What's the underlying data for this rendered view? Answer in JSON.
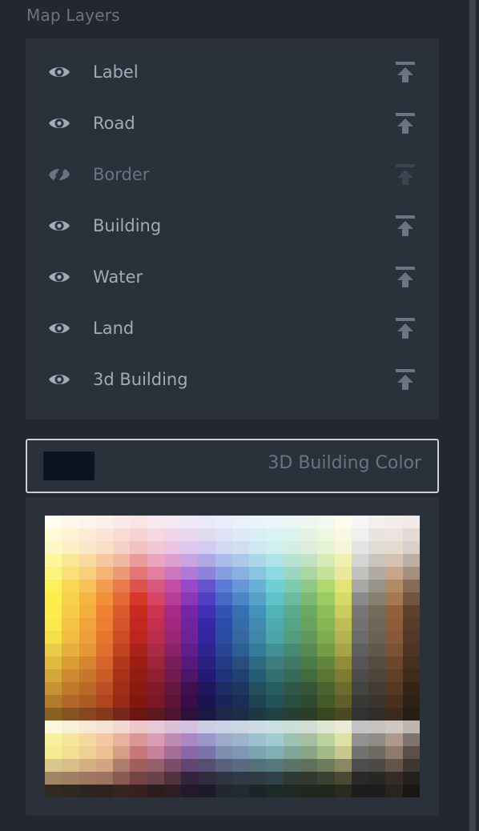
{
  "section_title": "Map Layers",
  "layers": [
    {
      "label": "Label",
      "visible": true,
      "eye_icon": "eye-icon",
      "action_icon": "move-to-top-icon"
    },
    {
      "label": "Road",
      "visible": true,
      "eye_icon": "eye-icon",
      "action_icon": "move-to-top-icon"
    },
    {
      "label": "Border",
      "visible": false,
      "eye_icon": "eye-slash-icon",
      "action_icon": "move-to-top-icon"
    },
    {
      "label": "Building",
      "visible": true,
      "eye_icon": "eye-icon",
      "action_icon": "move-to-top-icon"
    },
    {
      "label": "Water",
      "visible": true,
      "eye_icon": "eye-icon",
      "action_icon": "move-to-top-icon"
    },
    {
      "label": "Land",
      "visible": true,
      "eye_icon": "eye-icon",
      "action_icon": "move-to-top-icon"
    },
    {
      "label": "3d Building",
      "visible": true,
      "eye_icon": "eye-icon",
      "action_icon": "move-to-top-icon"
    }
  ],
  "color_picker": {
    "label": "3D Building Color",
    "selected_color": "#0c1320"
  },
  "colors": {
    "icon_visible": "#a3a9b5",
    "icon_hidden": "#6b7280",
    "action_visible": "#6b7384",
    "action_hidden": "#3f4550"
  },
  "palette": [
    [
      "#fffeee",
      "#fef8ec",
      "#fdf5ec",
      "#fbf0ea",
      "#f9ebea",
      "#f9e5e5",
      "#f8e9f0",
      "#f4e8f2",
      "#efe8f7",
      "#ebe9f7",
      "#eaedf9",
      "#e9f1f9",
      "#e9f4f9",
      "#e8f7fa",
      "#ecf7f5",
      "#eff6ef",
      "#f3f9ee",
      "#fbfcec",
      "#f6f6f7",
      "#f2f1ee",
      "#f3eeea",
      "#f0ebe8"
    ],
    [
      "#fefbd6",
      "#fef4d2",
      "#fcecd6",
      "#fbe5d7",
      "#f8dcd4",
      "#f5d2d4",
      "#f6d8e2",
      "#f0d6ea",
      "#e9d8f1",
      "#e1dbf1",
      "#dde2f6",
      "#dde9f5",
      "#dceef5",
      "#d9f2f6",
      "#dcf2ec",
      "#e6f0e5",
      "#eef7df",
      "#f8f8e3",
      "#f0f0f0",
      "#e8e5e1",
      "#ede4df",
      "#e3dcd6"
    ],
    [
      "#fef8c4",
      "#fcf0c4",
      "#fae8c9",
      "#f9dfc6",
      "#f6d2c6",
      "#f2c2c3",
      "#f2c8d7",
      "#eac4e3",
      "#dec7ee",
      "#d1cdf0",
      "#d1d9f2",
      "#cfdff0",
      "#cfe6f3",
      "#cfeff1",
      "#d5eee4",
      "#dcedd9",
      "#e6f4d4",
      "#f5f6d9",
      "#e3e3e3",
      "#dfdcd6",
      "#e5dace",
      "#d9d0cb"
    ],
    [
      "#fef89a",
      "#fbe897",
      "#f8da9e",
      "#f7c8a0",
      "#f0b7a2",
      "#e89c9d",
      "#eba6be",
      "#dca1d3",
      "#c9a3e2",
      "#b0a8e4",
      "#adbde9",
      "#acc9e8",
      "#acd7e8",
      "#aee4e8",
      "#b6e2d4",
      "#c5e1c4",
      "#d6ebb6",
      "#f0f1b0",
      "#d4d4d2",
      "#c9c4bc",
      "#d6c2b0",
      "#bcafa4"
    ],
    [
      "#fdf47e",
      "#fbdf7b",
      "#f8cf7c",
      "#f4b478",
      "#eb9a75",
      "#e37673",
      "#e17fa0",
      "#cd78bd",
      "#b078d7",
      "#8b84da",
      "#879fe0",
      "#88b1de",
      "#8ac5df",
      "#8ddbe0",
      "#9ad6c2",
      "#abd6a2",
      "#c3e399",
      "#eae89b",
      "#c1c1c1",
      "#b0aaa0",
      "#c7a588",
      "#a48f82"
    ],
    [
      "#fdf05a",
      "#f9d755",
      "#f6c35a",
      "#f19c4f",
      "#e87b4b",
      "#db544b",
      "#d9567c",
      "#c04ea4",
      "#9849c8",
      "#6553cd",
      "#5b7cd4",
      "#6698d7",
      "#67b2d4",
      "#6ecfd5",
      "#7ccbae",
      "#90c789",
      "#add970",
      "#e3e477",
      "#a7a7a7",
      "#99948a",
      "#b38a66",
      "#866c57"
    ],
    [
      "#fdee4b",
      "#f8d04a",
      "#f5b542",
      "#f19039",
      "#e36935",
      "#d5372b",
      "#d64466",
      "#b53f97",
      "#8b38b8",
      "#4d3ec2",
      "#466ac4",
      "#4c86c6",
      "#54a2c9",
      "#5ec3ca",
      "#6bbba0",
      "#7fb874",
      "#9bcc63",
      "#d5db67",
      "#8b8b8b",
      "#858070",
      "#a37852",
      "#715540"
    ],
    [
      "#fcec4e",
      "#f8cb46",
      "#f4ae3c",
      "#ef8231",
      "#dc5a2f",
      "#cb2a1f",
      "#cc3551",
      "#a82a86",
      "#7624a8",
      "#3d30b2",
      "#3053b4",
      "#3770b2",
      "#4094bb",
      "#51b3b8",
      "#58ab8c",
      "#6aa962",
      "#8bbe56",
      "#cacd5d",
      "#767676",
      "#756d5c",
      "#925f3b",
      "#5d412a"
    ],
    [
      "#fbe84d",
      "#f6c246",
      "#f2a43c",
      "#ec7d31",
      "#d4542c",
      "#c2281f",
      "#c3304f",
      "#a0277e",
      "#70239e",
      "#3528a6",
      "#2b4da9",
      "#356ba9",
      "#418cae",
      "#4fabb2",
      "#56a487",
      "#68a25e",
      "#86b654",
      "#bdbd58",
      "#727272",
      "#6f6858",
      "#8c5d3a",
      "#573d29"
    ],
    [
      "#f6e047",
      "#f1bc43",
      "#ee9f3b",
      "#e7752e",
      "#cd4c26",
      "#bb261d",
      "#b82d49",
      "#992675",
      "#6d2398",
      "#32279f",
      "#2b4ba2",
      "#3567a3",
      "#3f87a6",
      "#4ba5ab",
      "#529c80",
      "#629759",
      "#80ac50",
      "#b2b451",
      "#6b6b6b",
      "#6a6353",
      "#87583a",
      "#523927"
    ],
    [
      "#ebcc48",
      "#e7af3e",
      "#e49937",
      "#e07030",
      "#c1441f",
      "#a92319",
      "#aa2b45",
      "#8a2169",
      "#611f8b",
      "#2d248f",
      "#274495",
      "#2d5e96",
      "#367b98",
      "#418f97",
      "#478a72",
      "#578950",
      "#729c45",
      "#a3a548",
      "#5f5f5f",
      "#5f594b",
      "#7a5133",
      "#4c3523"
    ],
    [
      "#e1ba3e",
      "#dc9c35",
      "#d98430",
      "#d6652b",
      "#b0391c",
      "#9c1d14",
      "#9c2539",
      "#7a1e5b",
      "#551a7a",
      "#272081",
      "#223b87",
      "#264f7f",
      "#2c6a82",
      "#3a7e7d",
      "#3f7866",
      "#4b7b45",
      "#62853b",
      "#8f8d3c",
      "#555555",
      "#554d42",
      "#6b482d",
      "#44301f"
    ],
    [
      "#d5a73a",
      "#cd8a32",
      "#c8762c",
      "#c85b26",
      "#a83219",
      "#941b12",
      "#8f2033",
      "#701a4e",
      "#4c1669",
      "#231b73",
      "#1e3478",
      "#214270",
      "#275d72",
      "#336e71",
      "#386a5a",
      "#426b3e",
      "#5a7534",
      "#7e7b34",
      "#4c4c4c",
      "#4d443a",
      "#5f3f26",
      "#3d2b1c"
    ],
    [
      "#c59333",
      "#c07a2c",
      "#b96927",
      "#bd4e22",
      "#a02e16",
      "#8d1a10",
      "#82192a",
      "#631842",
      "#3e1052",
      "#1e1760",
      "#1b2d62",
      "#1c365e",
      "#234e5b",
      "#285d5e",
      "#2f5849",
      "#375535",
      "#4c622c",
      "#6b6c2e",
      "#444444",
      "#433c34",
      "#563922",
      "#342417"
    ],
    [
      "#b57b2d",
      "#b36829",
      "#ac5a23",
      "#ae461e",
      "#962c17",
      "#83170f",
      "#7a1923",
      "#5d1434",
      "#380d48",
      "#1a1352",
      "#182558",
      "#192f55",
      "#1f4352",
      "#23535a",
      "#294f42",
      "#2f4b2e",
      "#445a28",
      "#605f29",
      "#383838",
      "#3b352d",
      "#4a301d",
      "#2e2116"
    ],
    [
      "#866121",
      "#855220",
      "#874620",
      "#86381b",
      "#76271a",
      "#6b1611",
      "#5d1820",
      "#4b1530",
      "#2f103c",
      "#191846",
      "#1e2745",
      "#1c2d46",
      "#1d3843",
      "#1e4244",
      "#253f37",
      "#2b3f28",
      "#394622",
      "#4c4822",
      "#323232",
      "#302d28",
      "#3b2a1d",
      "#261d15"
    ],
    [
      "#fbf8dc",
      "#f8f1d8",
      "#f7e9d6",
      "#f5e3d4",
      "#f2d9d1",
      "#ecc8ca",
      "#e9c9d7",
      "#dbc2d8",
      "#d3c3e0",
      "#cdcde4",
      "#cdd3e6",
      "#cbd6e3",
      "#cbdce3",
      "#c8e1e1",
      "#cbdfd8",
      "#d3ddd4",
      "#dfe6d4",
      "#e9ebd6",
      "#c4c4c4",
      "#c5c3bf",
      "#d1c7c2",
      "#bcb7b1"
    ],
    [
      "#f9f29c",
      "#f6e59d",
      "#f3d89f",
      "#f2c8a5",
      "#e7b3a0",
      "#db9798",
      "#d89db3",
      "#be8cb3",
      "#ac88c3",
      "#9c97c9",
      "#9eabcb",
      "#9fb4cb",
      "#9dc1cd",
      "#a1cbd2",
      "#9dc2b4",
      "#a7bfa1",
      "#bcd2a1",
      "#dde1a4",
      "#929292",
      "#908b85",
      "#af9a89",
      "#7f7570"
    ],
    [
      "#f6ed93",
      "#f4df91",
      "#efd092",
      "#eebf93",
      "#d69e86",
      "#c77978",
      "#c6819c",
      "#a56c96",
      "#8c67a6",
      "#7873ab",
      "#7e8eb1",
      "#7d98b3",
      "#7ba4b3",
      "#7fb1b4",
      "#7fa797",
      "#8aa583",
      "#a3ba88",
      "#c6c890",
      "#727272",
      "#6e6a62",
      "#8e7b6a",
      "#5c4f46"
    ],
    [
      "#d9c889",
      "#d9be86",
      "#d6af81",
      "#d3a47f",
      "#ac7d6d",
      "#9f5f5d",
      "#94606e",
      "#7c4d68",
      "#634670",
      "#574f73",
      "#58607a",
      "#586b7f",
      "#54707a",
      "#56797d",
      "#597368",
      "#5f7159",
      "#6e7b5c",
      "#888862",
      "#4d4d4d",
      "#4c4a45",
      "#635549",
      "#3f3632"
    ],
    [
      "#a08563",
      "#9f8063",
      "#9e7860",
      "#9c7360",
      "#855a4f",
      "#744444",
      "#68434a",
      "#4e333e",
      "#33233b",
      "#2e2d3f",
      "#2e3442",
      "#2f3846",
      "#2e3a42",
      "#2f4248",
      "#2d3b36",
      "#323a2f",
      "#39412f",
      "#4a4a34",
      "#292929",
      "#272724",
      "#352b27",
      "#23201d"
    ],
    [
      "#312a21",
      "#30271f",
      "#2d2520",
      "#2e221f",
      "#35241f",
      "#37211e",
      "#2c1c1d",
      "#2e1e24",
      "#22192a",
      "#1b1a27",
      "#22262f",
      "#232931",
      "#1a2429",
      "#1e2a28",
      "#212823",
      "#23261f",
      "#23251f",
      "#2a2a1e",
      "#1d1d1d",
      "#1e1d1c",
      "#2a241f",
      "#1a1612"
    ]
  ]
}
